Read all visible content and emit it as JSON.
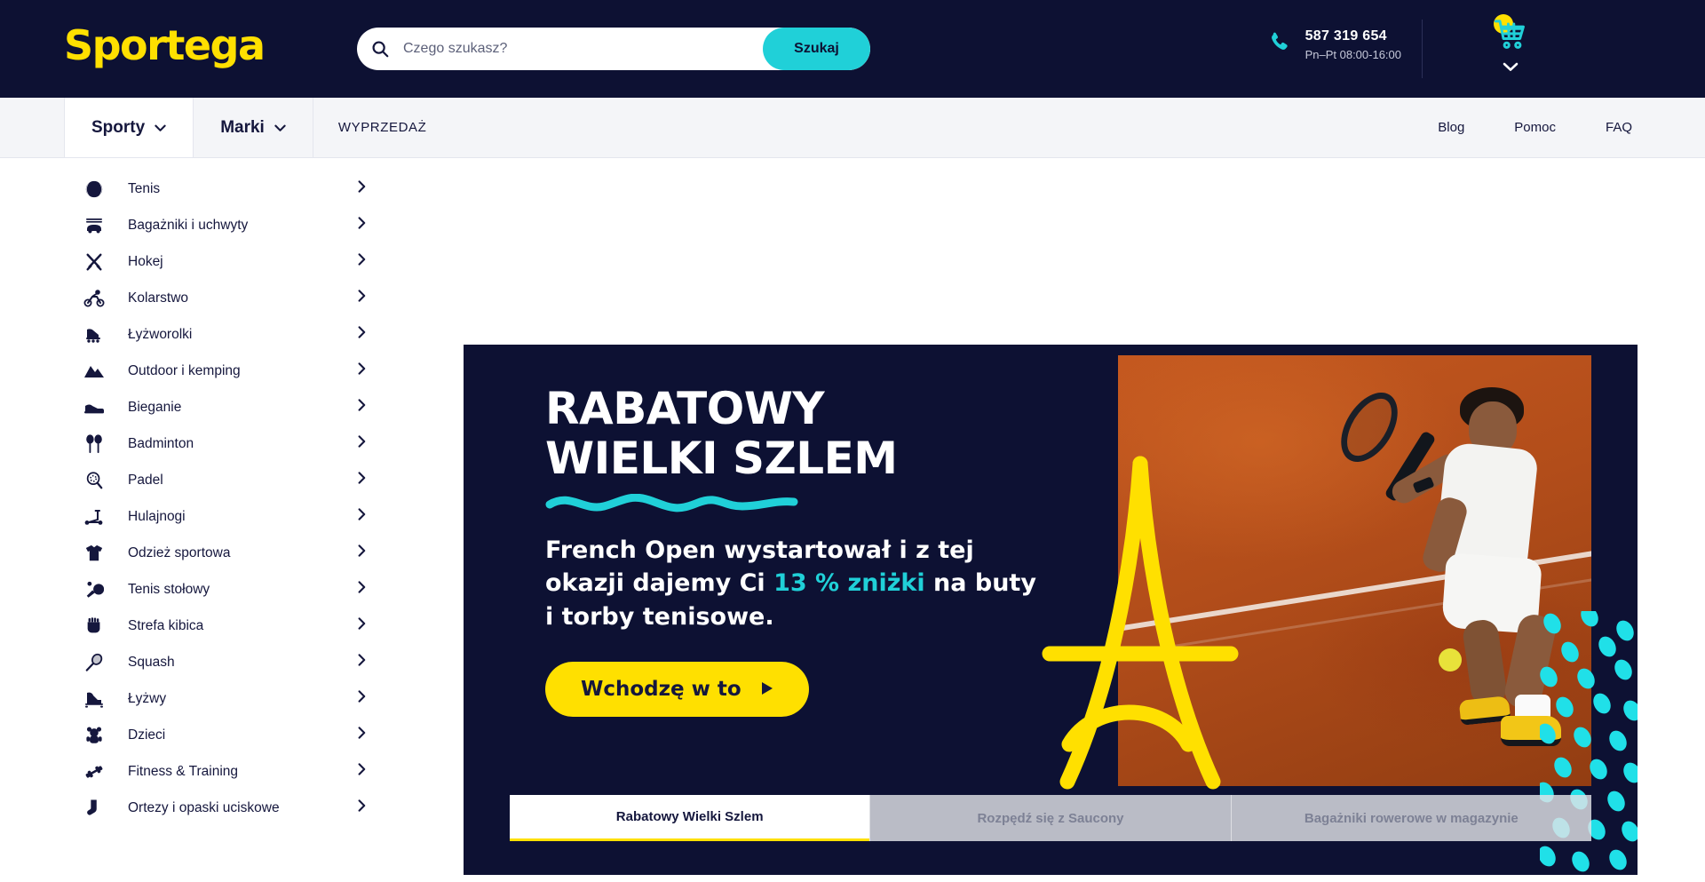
{
  "header": {
    "logo": "Sportega",
    "search": {
      "placeholder": "Czego szukasz?",
      "value": "",
      "button_label": "Szukaj",
      "icon": "search-icon"
    },
    "phone": {
      "icon": "phone-icon",
      "number": "587 319 654",
      "hours": "Pn–Pt 08:00-16:00"
    },
    "cart": {
      "icon": "shopping-cart-icon",
      "badge": "",
      "chevron": "chevron-down-icon"
    },
    "colors": {
      "background": "#0d1133",
      "logo": "#ffe000",
      "accent": "#20d0d8"
    }
  },
  "nav": {
    "items": [
      {
        "label": "Sporty",
        "active": true,
        "has_chevron": true
      },
      {
        "label": "Marki",
        "active": false,
        "has_chevron": true
      },
      {
        "label": "WYPRZEDAŻ",
        "active": false,
        "has_chevron": false
      }
    ],
    "links": [
      "Blog",
      "Pomoc",
      "FAQ"
    ]
  },
  "sidebar": {
    "items": [
      {
        "label": "Tenis",
        "icon": "tennis-ball-icon"
      },
      {
        "label": "Bagażniki i uchwyty",
        "icon": "car-rack-icon"
      },
      {
        "label": "Hokej",
        "icon": "hockey-sticks-icon"
      },
      {
        "label": "Kolarstwo",
        "icon": "cyclist-icon"
      },
      {
        "label": "Łyżworolki",
        "icon": "roller-skate-icon"
      },
      {
        "label": "Outdoor i kemping",
        "icon": "mountain-icon"
      },
      {
        "label": "Bieganie",
        "icon": "running-shoe-icon"
      },
      {
        "label": "Badminton",
        "icon": "badminton-rackets-icon"
      },
      {
        "label": "Padel",
        "icon": "padel-racket-icon"
      },
      {
        "label": "Hulajnogi",
        "icon": "scooter-icon"
      },
      {
        "label": "Odzież sportowa",
        "icon": "tshirt-icon"
      },
      {
        "label": "Tenis stołowy",
        "icon": "table-tennis-icon"
      },
      {
        "label": "Strefa kibica",
        "icon": "fist-icon"
      },
      {
        "label": "Squash",
        "icon": "squash-racket-icon"
      },
      {
        "label": "Łyżwy",
        "icon": "ice-skate-icon"
      },
      {
        "label": "Dzieci",
        "icon": "teddy-bear-icon"
      },
      {
        "label": "Fitness & Training",
        "icon": "dumbbell-icon"
      },
      {
        "label": "Ortezy i opaski uciskowe",
        "icon": "compression-sock-icon"
      }
    ],
    "arrow_icon": "chevron-right-icon"
  },
  "hero": {
    "title_line1": "RABATOWY",
    "title_line2": "WIELKI SZLEM",
    "subtitle_part1": "French Open wystartował i z tej okazji dajemy Ci ",
    "subtitle_highlight": "13 % zniżki",
    "subtitle_part2": " na buty i torby tenisowe.",
    "cta_label": "Wchodzę w to",
    "cta_icon": "play-triangle-icon",
    "image_alt": "tennis-player-clay-court",
    "decor": [
      "eiffel-tower-outline",
      "teal-dot-pattern",
      "teal-squiggle"
    ],
    "colors": {
      "background": "#0d1133",
      "cta": "#ffe000",
      "highlight": "#20d0d8"
    }
  },
  "carousel": {
    "tabs": [
      {
        "label": "Rabatowy Wielki Szlem",
        "active": true
      },
      {
        "label": "Rozpędź się z Saucony",
        "active": false
      },
      {
        "label": "Bagażniki rowerowe w magazynie",
        "active": false
      }
    ]
  }
}
